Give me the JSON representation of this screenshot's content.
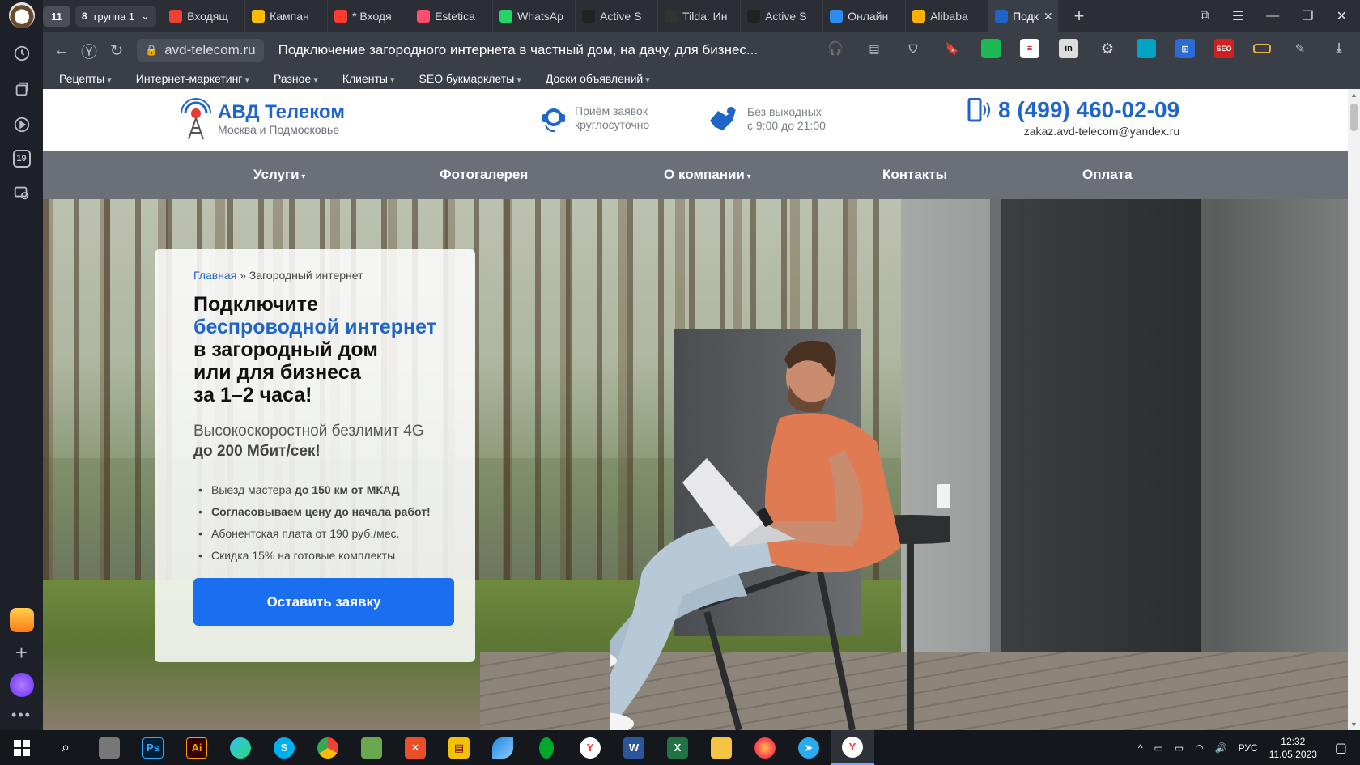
{
  "browser": {
    "tab_count": "11",
    "group": {
      "count": "8",
      "label": "группа 1"
    },
    "tabs": [
      {
        "label": "Входящ",
        "color": "#ea4335"
      },
      {
        "label": "Кампан",
        "color": "#fbbc04"
      },
      {
        "label": "* Входя",
        "color": "#ff3b30"
      },
      {
        "label": "Estetica",
        "color": "#ff4d6d"
      },
      {
        "label": "WhatsAp",
        "color": "#25d366"
      },
      {
        "label": "Active S",
        "color": "#222222"
      },
      {
        "label": "Tilda: Ин",
        "color": "#333333"
      },
      {
        "label": "Active S",
        "color": "#222222"
      },
      {
        "label": "Онлайн",
        "color": "#2d8cf0"
      },
      {
        "label": "Alibaba",
        "color": "#ffb000"
      },
      {
        "label": "Подк",
        "color": "#1f64c8",
        "active": true
      }
    ],
    "url": "avd-telecom.ru",
    "page_title": "Подключение загородного интернета в частный дом, на дачу, для бизнес...",
    "bookmarks": [
      "Рецепты",
      "Интернет-маркетинг",
      "Разное",
      "Клиенты",
      "SEO букмарклеты",
      "Доски объявлений"
    ],
    "sidebar_badge": "19"
  },
  "site": {
    "brand": "АВД Телеком",
    "region": "Москва и Подмосковье",
    "info1": {
      "line1": "Приём заявок",
      "line2": "круглосуточно"
    },
    "info2": {
      "line1": "Без выходных",
      "line2": "с 9:00 до 21:00"
    },
    "phone": "8 (499) 460-02-09",
    "email": "zakaz.avd-telecom@yandex.ru",
    "menu": [
      "Услуги",
      "Фотогалерея",
      "О компании",
      "Контакты",
      "Оплата"
    ],
    "breadcrumb": {
      "home": "Главная",
      "sep": "»",
      "current": "Загородный интернет"
    },
    "headline": {
      "part1": "Подключите",
      "highlight": "беспроводной интернет",
      "part2": "в загородный дом",
      "part3": "или для бизнеса",
      "part4": "за 1–2 часа!"
    },
    "subtitle": {
      "line1": "Высокоскоростной безлимит 4G",
      "line2": "до 200 Мбит/сек!"
    },
    "features": [
      {
        "text": "Выезд мастера ",
        "bold": "до 150 км от МКАД"
      },
      {
        "text": "",
        "bold": "Согласовываем цену до начала работ!"
      },
      {
        "text": "Абонентская плата от 190 руб./мес.",
        "bold": ""
      },
      {
        "text": "Скидка 15% на готовые комплекты",
        "bold": ""
      }
    ],
    "cta": "Оставить заявку",
    "accent": "#1f64c8",
    "button_color": "#1a6ef0"
  },
  "taskbar": {
    "lang": "РУС",
    "time": "12:32",
    "date": "11.05.2023",
    "apps": [
      "Ps",
      "Ai",
      "S",
      "W",
      "X"
    ]
  }
}
